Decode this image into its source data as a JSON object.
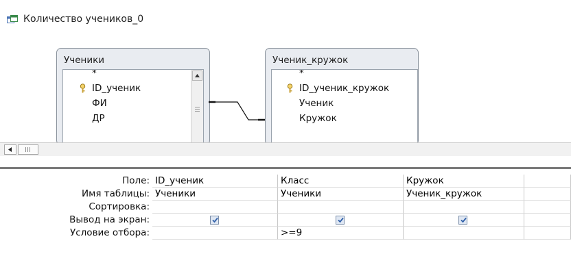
{
  "window": {
    "title": "Количество учеников_0"
  },
  "tables": [
    {
      "name": "Ученики",
      "fields": [
        "*",
        "ID_ученик",
        "ФИ",
        "ДР"
      ]
    },
    {
      "name": "Ученик_кружок",
      "fields": [
        "*",
        "ID_ученик_кружок",
        "Ученик",
        "Кружок"
      ]
    }
  ],
  "grid": {
    "row_labels": [
      "Поле:",
      "Имя таблицы:",
      "Сортировка:",
      "Вывод на экран:",
      "Условие отбора:"
    ],
    "columns": [
      {
        "field": "ID_ученик",
        "table": "Ученики",
        "sort": "",
        "show": true,
        "criteria": ""
      },
      {
        "field": "Класс",
        "table": "Ученики",
        "sort": "",
        "show": true,
        "criteria": ">=9"
      },
      {
        "field": "Кружок",
        "table": "Ученик_кружок",
        "sort": "",
        "show": true,
        "criteria": ""
      },
      {
        "field": "",
        "table": "",
        "sort": "",
        "show": false,
        "criteria": ""
      }
    ]
  },
  "colors": {
    "checkbox_check": "#2f5fa8",
    "table_box_bg": "#e9ecf1",
    "splitter": "#7a7a7a"
  }
}
